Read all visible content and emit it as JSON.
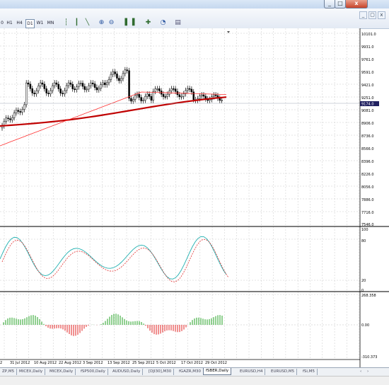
{
  "window": {
    "minimize": "_",
    "restore": "□",
    "close": "x"
  },
  "mdi": {
    "minimize": "_",
    "restore": "▢",
    "close": "x"
  },
  "toolbar": {
    "timeframes": [
      "H1",
      "H4",
      "D1",
      "W1",
      "MN"
    ],
    "active_timeframe": "D1",
    "leading_partial": "0",
    "icons": [
      "bar-chart-icon",
      "candlestick-icon",
      "line-chart-icon",
      "zoom-in-icon",
      "zoom-out-icon",
      "tile-icon",
      "autoscroll-icon",
      "indicators-icon",
      "periods-icon",
      "templates-icon"
    ]
  },
  "price_axis": {
    "labels": [
      "10101.0",
      "9931.0",
      "9761.0",
      "9591.0",
      "9421.0",
      "9251.0",
      "9081.0",
      "8906.0",
      "8736.0",
      "8566.0",
      "8396.0",
      "8226.0",
      "8056.0",
      "7886.0",
      "7716.0",
      "7546.0"
    ],
    "current_price": "9174.0"
  },
  "stoch_axis": {
    "top": "100",
    "upper": "80",
    "lower": "20",
    "bottom": "0"
  },
  "macd_axis": {
    "top": "268.358",
    "mid": "0.00",
    "bottom": "-310.373"
  },
  "time_axis": [
    "2",
    "31 Jul 2012",
    "10 Aug 2012",
    "22 Aug 2012",
    "3 Sep 2012",
    "13 Sep 2012",
    "25 Sep 2012",
    "5 Oct 2012",
    "17 Oct 2012",
    "29 Oct 2012"
  ],
  "tabs": [
    "ZP,M5",
    "MICEX,Daily",
    "MICEX,Daily",
    "fSP500,Daily",
    "AUDUSD,Daily",
    "[DJI30],M30",
    "fGAZR,M30",
    "fSBER,Daily",
    "EURUSD,H4",
    "EURUSD,M5",
    "fSi,M5"
  ],
  "active_tab": "fSBER,Daily",
  "colors": {
    "price_line": "#c00000",
    "ma_fast": "#ff3030",
    "stoch_main": "#20b0b0",
    "stoch_signal": "#e03030",
    "histogram_up": "#20a020",
    "histogram_down": "#e02020",
    "current_price_bg": "#202060"
  }
}
